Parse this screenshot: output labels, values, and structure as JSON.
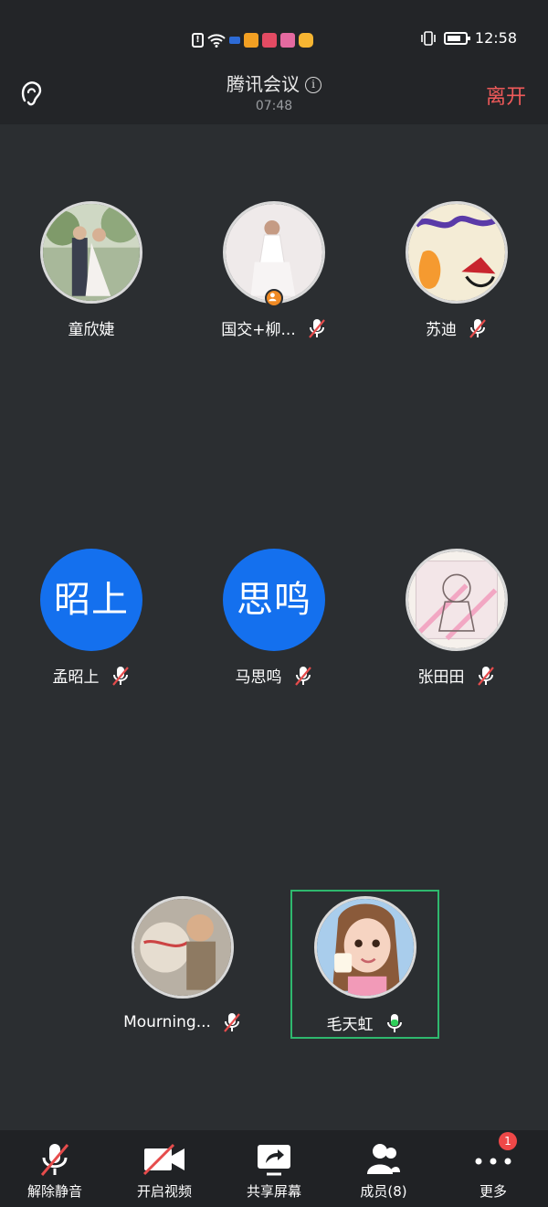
{
  "status_bar": {
    "time": "12:58",
    "icons": [
      "sim-alert-icon",
      "wifi-icon",
      "app-icon-1",
      "app-icon-2",
      "app-icon-3",
      "app-icon-4",
      "app-icon-5",
      "vibrate-icon",
      "battery-icon"
    ]
  },
  "header": {
    "title": "腾讯会议",
    "duration": "07:48",
    "leave_label": "离开",
    "leave_color": "#f05a5a"
  },
  "participants": [
    {
      "name": "童欣婕",
      "avatar_type": "photo",
      "muted": null
    },
    {
      "name": "国交+柳...",
      "avatar_type": "photo",
      "muted": true,
      "host": true
    },
    {
      "name": "苏迪",
      "avatar_type": "photo",
      "muted": true
    },
    {
      "name": "孟昭上",
      "avatar_type": "text",
      "avatar_text": "昭上",
      "muted": true
    },
    {
      "name": "马思鸣",
      "avatar_type": "text",
      "avatar_text": "思鸣",
      "muted": true
    },
    {
      "name": "张田田",
      "avatar_type": "photo",
      "muted": true
    },
    {
      "name": "Mourning...",
      "avatar_type": "photo",
      "muted": true
    },
    {
      "name": "毛天虹",
      "avatar_type": "photo",
      "muted": false,
      "speaking": true
    }
  ],
  "colors": {
    "avatar_blue": "#1470ee",
    "active_speaker_border": "#2fb86e",
    "muted_slash": "#e64c4c",
    "badge": "#ef4848"
  },
  "toolbar": {
    "unmute_label": "解除静音",
    "video_label": "开启视频",
    "share_label": "共享屏幕",
    "members_label": "成员(8)",
    "more_label": "更多",
    "more_badge": "1"
  }
}
